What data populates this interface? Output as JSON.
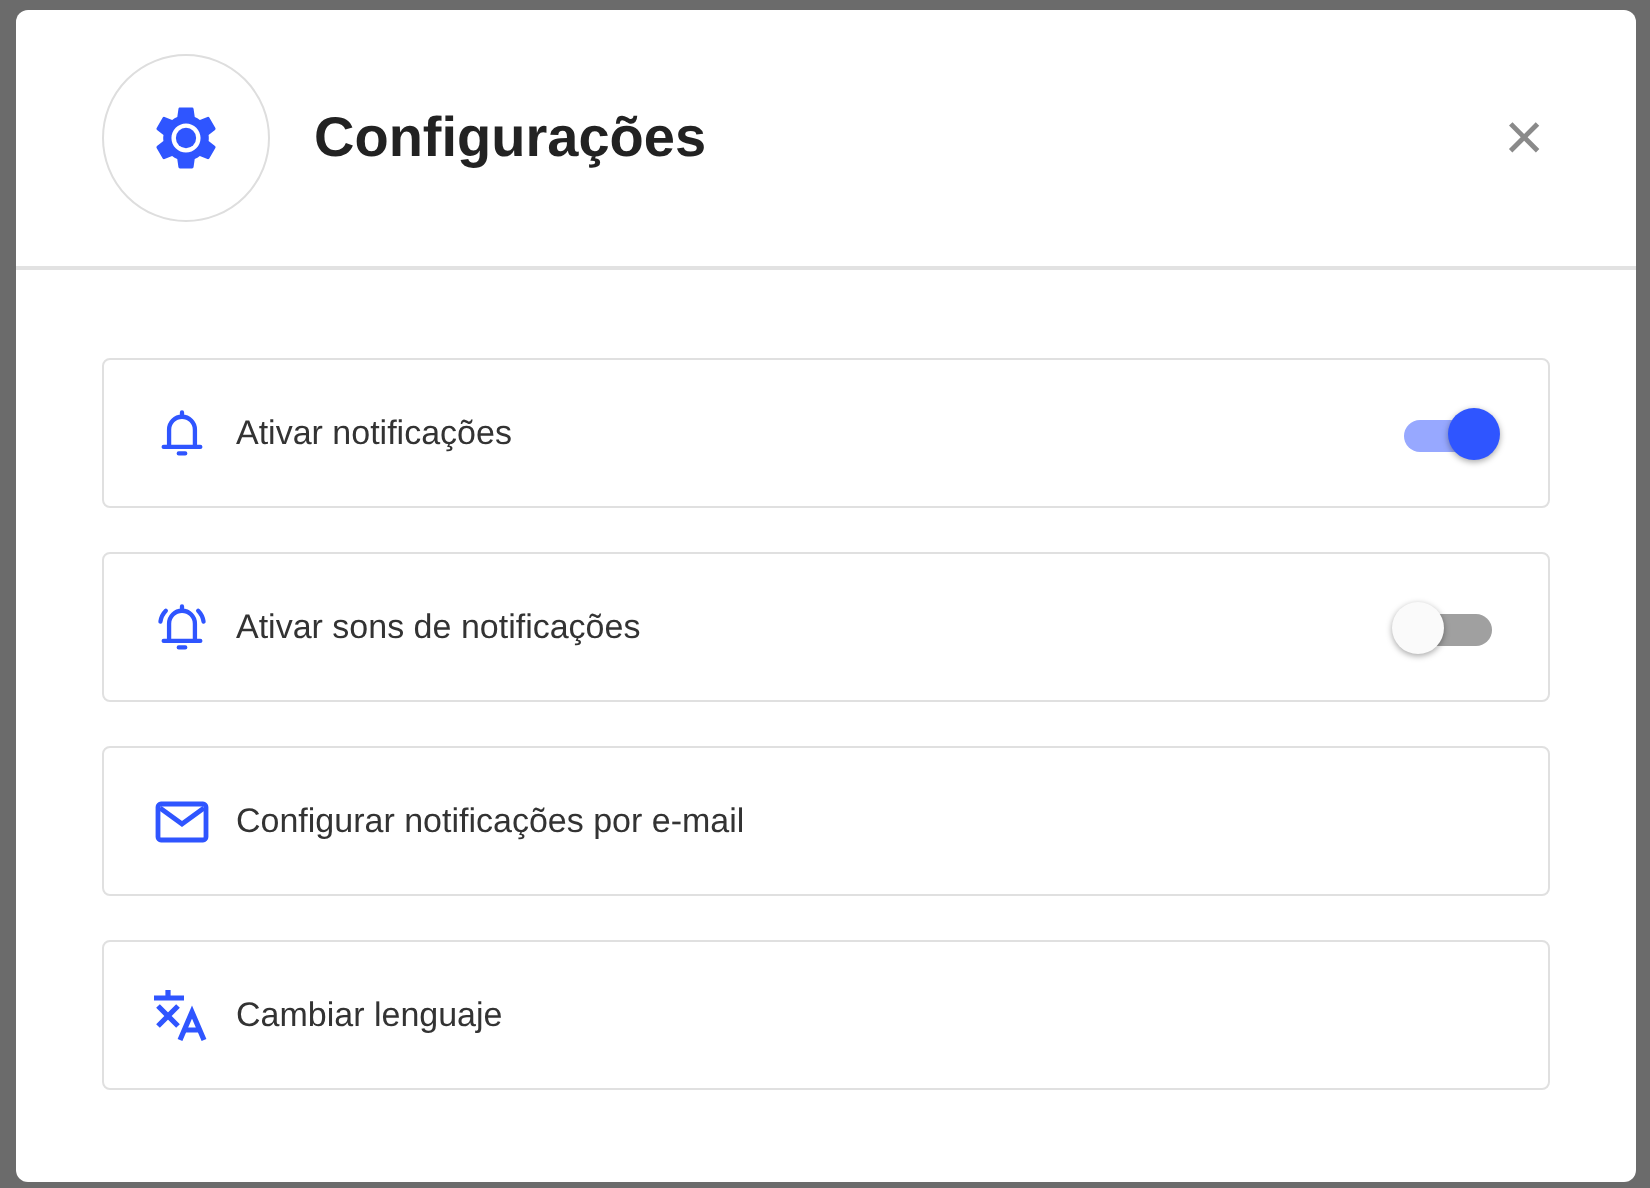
{
  "dialog": {
    "title": "Configurações",
    "close": "×"
  },
  "settings": [
    {
      "kind": "toggle",
      "label": "Ativar notificações",
      "on": true
    },
    {
      "kind": "toggle",
      "label": "Ativar sons de notificações",
      "on": false
    },
    {
      "kind": "link",
      "label": "Configurar notificações por e-mail"
    },
    {
      "kind": "link",
      "label": "Cambiar lenguaje"
    }
  ]
}
